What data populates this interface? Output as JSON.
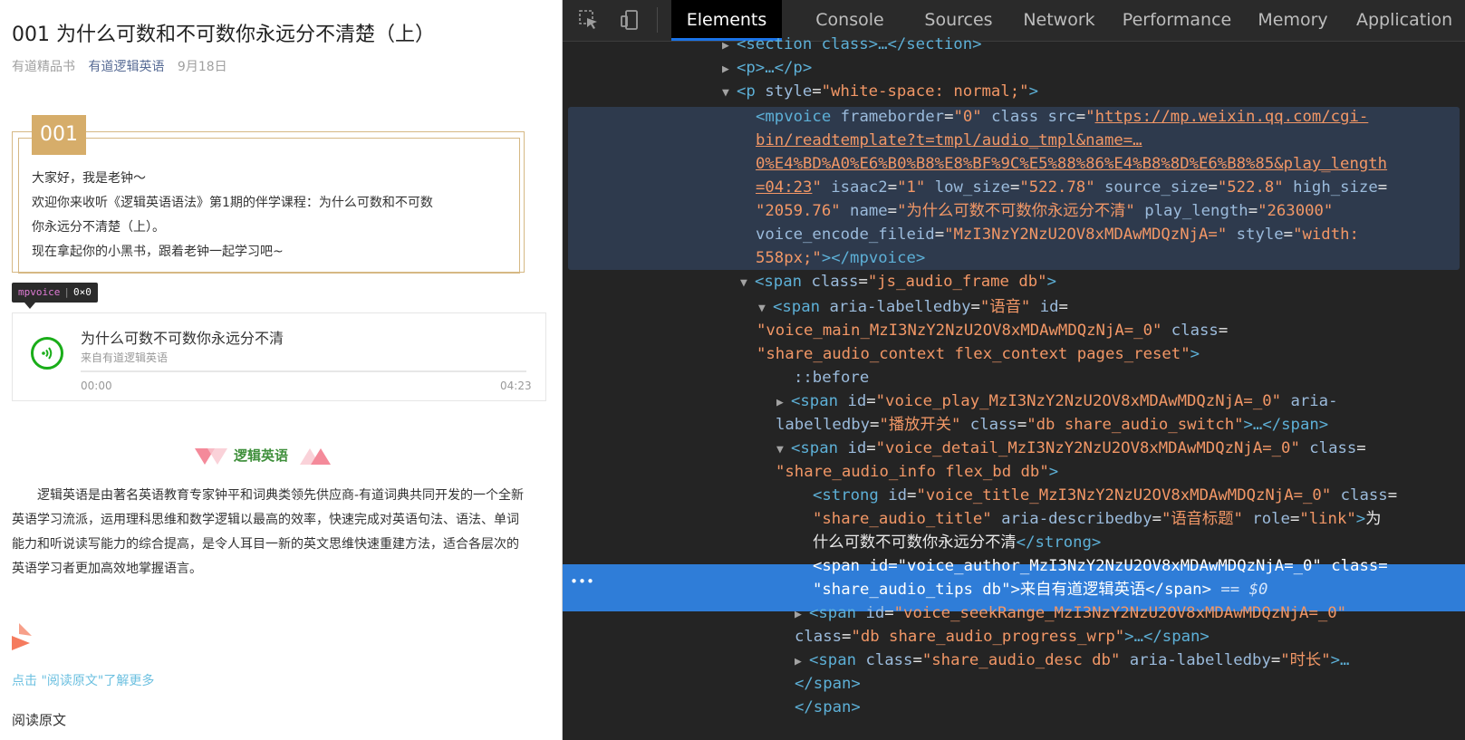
{
  "article": {
    "title": "001 为什么可数和不可数你永远分不清楚（上）",
    "source": "有道精品书",
    "account": "有道逻辑英语",
    "date": "9月18日",
    "badge": "001",
    "intro_lines": [
      "大家好，我是老钟～",
      "欢迎你来收听《逻辑英语语法》第1期的伴学课程：为什么可数和不可数",
      "你永远分不清楚（上）。",
      "现在拿起你的小黑书，跟着老钟一起学习吧~"
    ],
    "tooltip_name": "mpvoice",
    "tooltip_size": "0×0",
    "audio": {
      "title": "为什么可数不可数你永远分不清",
      "author": "来自有道逻辑英语",
      "progress": 0,
      "start_time": "00:00",
      "end_time": "04:23"
    },
    "section_title": "逻辑英语",
    "description_lines": [
      "逻辑英语是由著名英语教育专家钟平和词典类领先供应商-有道词典共同开发的一个全新",
      "英语学习流派，运用理科思维和数学逻辑以最高的效率，快速完成对英语句法、语法、单词",
      "能力和听说读写能力的综合提高，是令人耳目一新的英文思维快速重建方法，适合各层次的",
      "英语学习者更加高效地掌握语言。"
    ],
    "read_more": "点击 \"阅读原文\"了解更多",
    "read_original": "阅读原文"
  },
  "devtools": {
    "tabs": [
      "Elements",
      "Console",
      "Sources",
      "Network",
      "Performance",
      "Memory",
      "Application"
    ],
    "active_tab": "Elements",
    "icons": [
      "inspect-element-icon",
      "device-toolbar-icon"
    ],
    "lines": {
      "l0": "<section class>…</section>",
      "l1": "<p>…</p>",
      "l2_tag": "<p ",
      "l2_attr": "style",
      "l2_val": "\"white-space: normal;\"",
      "mp1_tag": "<mpvoice ",
      "mp1_a1": "frameborder",
      "mp1_v1": "\"0\"",
      "mp1_a2": " class src",
      "mp1_q": "\"",
      "mp1_u1": "https://mp.weixin.qq.com/cgi-",
      "mp2_u": "bin/readtemplate?t=tmpl/audio_tmpl&name=…",
      "mp3_u": "0%E4%BD%A0%E6%B0%B8%E8%BF%9C%E5%88%86%E4%B8%8D%E6%B8%85&play_length",
      "mp4_u": "=04:23",
      "mp4_a1": " isaac2",
      "mp4_v1": "\"1\"",
      "mp4_a2": " low_size",
      "mp4_v2": "\"522.78\"",
      "mp4_a3": " source_size",
      "mp4_v3": "\"522.8\"",
      "mp4_a4": " high_size",
      "mp5_v0": "\"2059.76\"",
      "mp5_a1": " name",
      "mp5_v1": "\"为什么可数不可数你永远分不清\"",
      "mp5_a2": " play_length",
      "mp5_v2": "\"263000\"",
      "mp6_a1": "voice_encode_fileid",
      "mp6_v1": "\"MzI3NzY2NzU2OV8xMDAwMDQzNjA=\"",
      "mp6_a2": " style",
      "mp6_v2": "\"width:",
      "mp7_v": "558px;\"",
      "mp7_close": "></mpvoice>",
      "f1_tag": "<span ",
      "f1_attr": "class",
      "f1_val": "\"js_audio_frame db\"",
      "f2_tag": "<span ",
      "f2_a1": "aria-labelledby",
      "f2_v1": "\"语音\"",
      "f2_a2": " id",
      "f3_v": "\"voice_main_MzI3NzY2NzU2OV8xMDAwMDQzNjA=_0\"",
      "f3_a": " class",
      "f4_v": "\"share_audio_context flex_context pages_reset\"",
      "before": "::before",
      "p1_tag": "<span ",
      "p1_a1": "id",
      "p1_v1": "\"voice_play_MzI3NzY2NzU2OV8xMDAwMDQzNjA=_0\"",
      "p1_a2": " aria-",
      "p2_a": "labelledby",
      "p2_v1": "\"播放开关\"",
      "p2_a2": " class",
      "p2_v2": "\"db share_audio_switch\"",
      "p2_end": ">…</span>",
      "d1_tag": "<span ",
      "d1_a1": "id",
      "d1_v1": "\"voice_detail_MzI3NzY2NzU2OV8xMDAwMDQzNjA=_0\"",
      "d1_a2": " class",
      "d2_v": "\"share_audio_info flex_bd db\"",
      "s1_tag": "<strong ",
      "s1_a1": "id",
      "s1_v1": "\"voice_title_MzI3NzY2NzU2OV8xMDAwMDQzNjA=_0\"",
      "s1_a2": " class",
      "s2_v1": "\"share_audio_title\"",
      "s2_a": " aria-describedby",
      "s2_v2": "\"语音标题\"",
      "s2_a3": " role",
      "s2_v3": "\"link\"",
      "s2_text": "为",
      "s3_text": "什么可数不可数你永远分不清",
      "s3_close": "</strong>",
      "sel1": "<span id=\"voice_author_MzI3NzY2NzU2OV8xMDAwMDQzNjA=_0\" class=",
      "sel2": "\"share_audio_tips db\">来自有道逻辑英语</span>",
      "sel_eq": " == $0",
      "k1_tag": "<span ",
      "k1_a1": "id",
      "k1_v1": "\"voice_seekRange_MzI3NzY2NzU2OV8xMDAwMDQzNjA=_0\"",
      "k2_a": "class",
      "k2_v": "\"db share_audio_progress_wrp\"",
      "k2_end": ">…</span>",
      "q1_tag": "<span ",
      "q1_a1": "class",
      "q1_v1": "\"share_audio_desc db\"",
      "q1_a2": " aria-labelledby",
      "q1_v2": "\"时长\"",
      "q1_end": ">…",
      "c1": "</span>",
      "c2": "</span>"
    }
  }
}
